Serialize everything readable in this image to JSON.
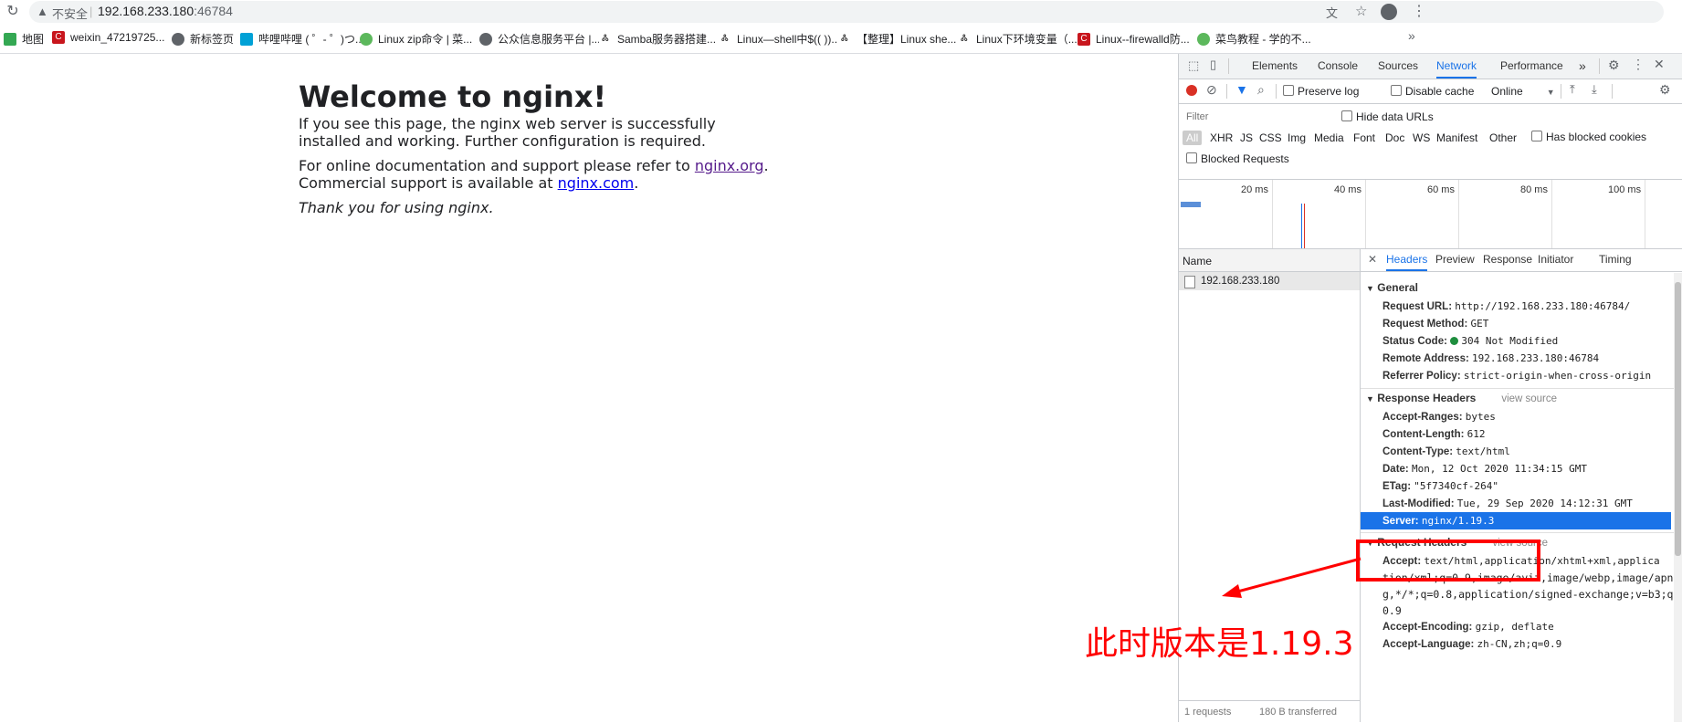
{
  "browser": {
    "security_label": "不安全",
    "url_host": "192.168.233.180",
    "url_port": ":46784"
  },
  "bookmarks": [
    {
      "label": "地图",
      "color": "#34a853",
      "icon": "map-icon"
    },
    {
      "label": "weixin_47219725...",
      "color": "#c8161d",
      "icon": "csdn-icon"
    },
    {
      "label": "新标签页",
      "color": "#5f6368",
      "icon": "globe-icon"
    },
    {
      "label": "哔哩哔哩 ( ゜- ゜)つ...",
      "color": "#00a1d6",
      "icon": "bilibili-icon"
    },
    {
      "label": "Linux zip命令 | 菜...",
      "color": "#5cb85c",
      "icon": "runoob-icon"
    },
    {
      "label": "公众信息服务平台 |...",
      "color": "#5f6368",
      "icon": "globe-icon"
    },
    {
      "label": "Samba服务器搭建...",
      "color": "#333333",
      "icon": "jianshu-icon"
    },
    {
      "label": "Linux—shell中$(( ))...",
      "color": "#333333",
      "icon": "jianshu-icon"
    },
    {
      "label": "【整理】Linux she...",
      "color": "#333333",
      "icon": "jianshu-icon"
    },
    {
      "label": "Linux下环境变量（...",
      "color": "#333333",
      "icon": "jianshu-icon"
    },
    {
      "label": "Linux--firewalld防...",
      "color": "#c8161d",
      "icon": "csdn-icon"
    },
    {
      "label": "菜鸟教程 - 学的不...",
      "color": "#5cb85c",
      "icon": "runoob-icon"
    }
  ],
  "page": {
    "title": "Welcome to nginx!",
    "p1": "If you see this page, the nginx web server is successfully installed and working. Further configuration is required.",
    "p2_prefix": "For online documentation and support please refer to ",
    "p2_link1": "nginx.org",
    "p2_mid": ".",
    "p2_line2": "Commercial support is available at ",
    "p2_link2": "nginx.com",
    "p2_end": ".",
    "p3": "Thank you for using nginx."
  },
  "devtools": {
    "tabs": [
      "Elements",
      "Console",
      "Sources",
      "Network",
      "Performance"
    ],
    "active_tab": "Network",
    "more": "»",
    "toolbar": {
      "preserve_log": "Preserve log",
      "disable_cache": "Disable cache",
      "throttle": "Online"
    },
    "filter_placeholder": "Filter",
    "hide_data_urls": "Hide data URLs",
    "types": [
      "All",
      "XHR",
      "JS",
      "CSS",
      "Img",
      "Media",
      "Font",
      "Doc",
      "WS",
      "Manifest",
      "Other"
    ],
    "has_blocked_cookies": "Has blocked cookies",
    "blocked_requests": "Blocked Requests",
    "timeline_labels": [
      "20 ms",
      "40 ms",
      "60 ms",
      "80 ms",
      "100 ms"
    ],
    "name_header": "Name",
    "request_name": "192.168.233.180",
    "status_bar": [
      "1 requests",
      "180 B transferred"
    ],
    "detail_tabs": [
      "Headers",
      "Preview",
      "Response",
      "Initiator",
      "Timing"
    ],
    "general": {
      "title": "General",
      "rows": [
        {
          "k": "Request URL:",
          "v": "http://192.168.233.180:46784/"
        },
        {
          "k": "Request Method:",
          "v": "GET"
        },
        {
          "k": "Status Code:",
          "v": "304 Not Modified"
        },
        {
          "k": "Remote Address:",
          "v": "192.168.233.180:46784"
        },
        {
          "k": "Referrer Policy:",
          "v": "strict-origin-when-cross-origin"
        }
      ]
    },
    "response_headers": {
      "title": "Response Headers",
      "view_source": "view source",
      "rows": [
        {
          "k": "Accept-Ranges:",
          "v": "bytes"
        },
        {
          "k": "Content-Length:",
          "v": "612"
        },
        {
          "k": "Content-Type:",
          "v": "text/html"
        },
        {
          "k": "Date:",
          "v": "Mon, 12 Oct 2020 11:34:15 GMT"
        },
        {
          "k": "ETag:",
          "v": "\"5f7340cf-264\""
        },
        {
          "k": "Last-Modified:",
          "v": "Tue, 29 Sep 2020 14:12:31 GMT"
        },
        {
          "k": "Server:",
          "v": "nginx/1.19.3"
        }
      ]
    },
    "request_headers": {
      "title": "Request Headers",
      "view_source": "view source",
      "accept_k": "Accept:",
      "accept_lines": [
        "text/html,application/xhtml+xml,applica",
        "tion/xml;q=0.9,image/avif,image/webp,image/apn",
        "g,*/*;q=0.8,application/signed-exchange;v=b3;q=",
        "0.9"
      ],
      "rows": [
        {
          "k": "Accept-Encoding:",
          "v": "gzip, deflate"
        },
        {
          "k": "Accept-Language:",
          "v": "zh-CN,zh;q=0.9"
        }
      ]
    }
  },
  "annotation": {
    "text": "此时版本是1.19.3",
    "color": "#ff0000"
  }
}
